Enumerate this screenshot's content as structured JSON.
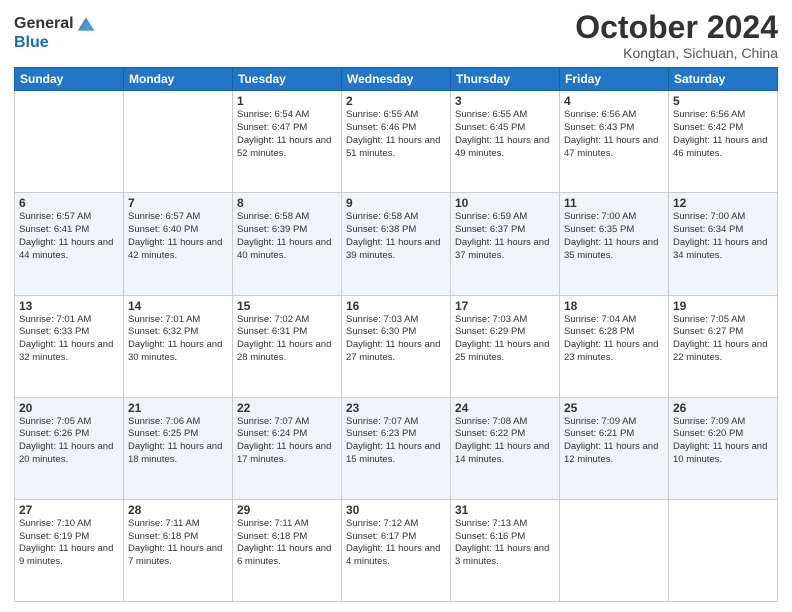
{
  "header": {
    "logo_line1": "General",
    "logo_line2": "Blue",
    "month": "October 2024",
    "location": "Kongtan, Sichuan, China"
  },
  "weekdays": [
    "Sunday",
    "Monday",
    "Tuesday",
    "Wednesday",
    "Thursday",
    "Friday",
    "Saturday"
  ],
  "weeks": [
    [
      null,
      null,
      {
        "day": "1",
        "sunrise": "6:54 AM",
        "sunset": "6:47 PM",
        "daylight": "11 hours and 52 minutes."
      },
      {
        "day": "2",
        "sunrise": "6:55 AM",
        "sunset": "6:46 PM",
        "daylight": "11 hours and 51 minutes."
      },
      {
        "day": "3",
        "sunrise": "6:55 AM",
        "sunset": "6:45 PM",
        "daylight": "11 hours and 49 minutes."
      },
      {
        "day": "4",
        "sunrise": "6:56 AM",
        "sunset": "6:43 PM",
        "daylight": "11 hours and 47 minutes."
      },
      {
        "day": "5",
        "sunrise": "6:56 AM",
        "sunset": "6:42 PM",
        "daylight": "11 hours and 46 minutes."
      }
    ],
    [
      {
        "day": "6",
        "sunrise": "6:57 AM",
        "sunset": "6:41 PM",
        "daylight": "11 hours and 44 minutes."
      },
      {
        "day": "7",
        "sunrise": "6:57 AM",
        "sunset": "6:40 PM",
        "daylight": "11 hours and 42 minutes."
      },
      {
        "day": "8",
        "sunrise": "6:58 AM",
        "sunset": "6:39 PM",
        "daylight": "11 hours and 40 minutes."
      },
      {
        "day": "9",
        "sunrise": "6:58 AM",
        "sunset": "6:38 PM",
        "daylight": "11 hours and 39 minutes."
      },
      {
        "day": "10",
        "sunrise": "6:59 AM",
        "sunset": "6:37 PM",
        "daylight": "11 hours and 37 minutes."
      },
      {
        "day": "11",
        "sunrise": "7:00 AM",
        "sunset": "6:35 PM",
        "daylight": "11 hours and 35 minutes."
      },
      {
        "day": "12",
        "sunrise": "7:00 AM",
        "sunset": "6:34 PM",
        "daylight": "11 hours and 34 minutes."
      }
    ],
    [
      {
        "day": "13",
        "sunrise": "7:01 AM",
        "sunset": "6:33 PM",
        "daylight": "11 hours and 32 minutes."
      },
      {
        "day": "14",
        "sunrise": "7:01 AM",
        "sunset": "6:32 PM",
        "daylight": "11 hours and 30 minutes."
      },
      {
        "day": "15",
        "sunrise": "7:02 AM",
        "sunset": "6:31 PM",
        "daylight": "11 hours and 28 minutes."
      },
      {
        "day": "16",
        "sunrise": "7:03 AM",
        "sunset": "6:30 PM",
        "daylight": "11 hours and 27 minutes."
      },
      {
        "day": "17",
        "sunrise": "7:03 AM",
        "sunset": "6:29 PM",
        "daylight": "11 hours and 25 minutes."
      },
      {
        "day": "18",
        "sunrise": "7:04 AM",
        "sunset": "6:28 PM",
        "daylight": "11 hours and 23 minutes."
      },
      {
        "day": "19",
        "sunrise": "7:05 AM",
        "sunset": "6:27 PM",
        "daylight": "11 hours and 22 minutes."
      }
    ],
    [
      {
        "day": "20",
        "sunrise": "7:05 AM",
        "sunset": "6:26 PM",
        "daylight": "11 hours and 20 minutes."
      },
      {
        "day": "21",
        "sunrise": "7:06 AM",
        "sunset": "6:25 PM",
        "daylight": "11 hours and 18 minutes."
      },
      {
        "day": "22",
        "sunrise": "7:07 AM",
        "sunset": "6:24 PM",
        "daylight": "11 hours and 17 minutes."
      },
      {
        "day": "23",
        "sunrise": "7:07 AM",
        "sunset": "6:23 PM",
        "daylight": "11 hours and 15 minutes."
      },
      {
        "day": "24",
        "sunrise": "7:08 AM",
        "sunset": "6:22 PM",
        "daylight": "11 hours and 14 minutes."
      },
      {
        "day": "25",
        "sunrise": "7:09 AM",
        "sunset": "6:21 PM",
        "daylight": "11 hours and 12 minutes."
      },
      {
        "day": "26",
        "sunrise": "7:09 AM",
        "sunset": "6:20 PM",
        "daylight": "11 hours and 10 minutes."
      }
    ],
    [
      {
        "day": "27",
        "sunrise": "7:10 AM",
        "sunset": "6:19 PM",
        "daylight": "11 hours and 9 minutes."
      },
      {
        "day": "28",
        "sunrise": "7:11 AM",
        "sunset": "6:18 PM",
        "daylight": "11 hours and 7 minutes."
      },
      {
        "day": "29",
        "sunrise": "7:11 AM",
        "sunset": "6:18 PM",
        "daylight": "11 hours and 6 minutes."
      },
      {
        "day": "30",
        "sunrise": "7:12 AM",
        "sunset": "6:17 PM",
        "daylight": "11 hours and 4 minutes."
      },
      {
        "day": "31",
        "sunrise": "7:13 AM",
        "sunset": "6:16 PM",
        "daylight": "11 hours and 3 minutes."
      },
      null,
      null
    ]
  ]
}
